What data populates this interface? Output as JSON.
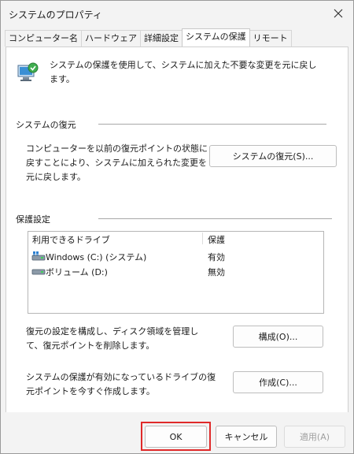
{
  "window": {
    "title": "システムのプロパティ"
  },
  "tabs": [
    {
      "label": "コンピューター名"
    },
    {
      "label": "ハードウェア"
    },
    {
      "label": "詳細設定"
    },
    {
      "label": "システムの保護"
    },
    {
      "label": "リモート"
    }
  ],
  "active_tab": "システムの保護",
  "intro": {
    "text": "システムの保護を使用して、システムに加えた不要な変更を元に戻します。"
  },
  "restore": {
    "section_title": "システムの復元",
    "description": "コンピューターを以前の復元ポイントの状態に戻すことにより、システムに加えられた変更を元に戻します。",
    "button_label": "システムの復元(S)..."
  },
  "protection": {
    "section_title": "保護設定",
    "columns": [
      "利用できるドライブ",
      "保護"
    ],
    "drives": [
      {
        "name": "Windows (C:) (システム)",
        "status": "有効",
        "icon": "system-drive-icon"
      },
      {
        "name": "ボリューム (D:)",
        "status": "無効",
        "icon": "drive-icon"
      }
    ],
    "configure": {
      "description": "復元の設定を構成し、ディスク領域を管理して、復元ポイントを削除します。",
      "button_label": "構成(O)..."
    },
    "create": {
      "description": "システムの保護が有効になっているドライブの復元ポイントを今すぐ作成します。",
      "button_label": "作成(C)..."
    }
  },
  "footer": {
    "ok": "OK",
    "cancel": "キャンセル",
    "apply": "適用(A)"
  },
  "colors": {
    "highlight_frame": "#e02a2a",
    "window_bg": "#f3f3f3",
    "panel_bg": "#ffffff"
  }
}
